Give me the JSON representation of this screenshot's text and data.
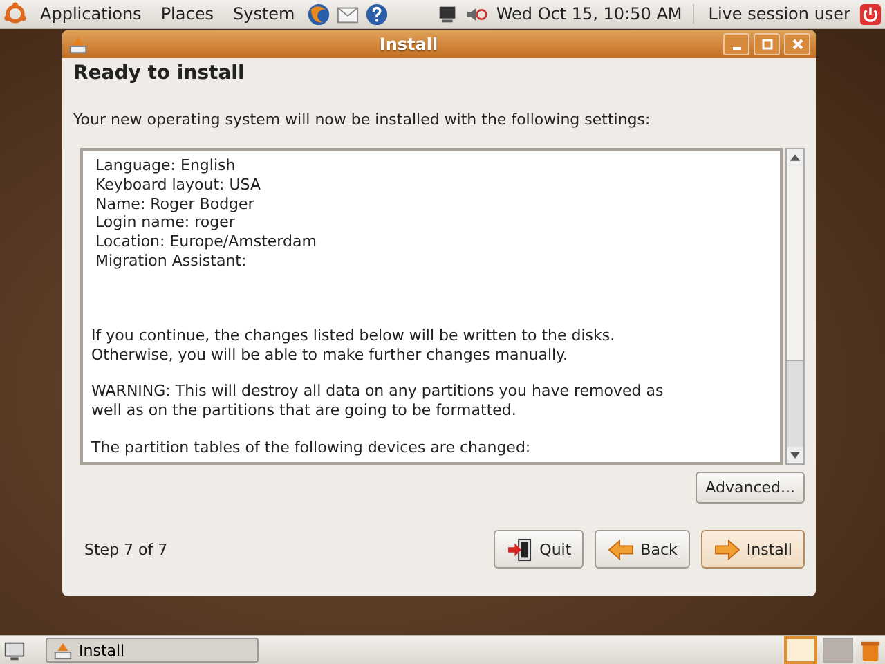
{
  "top_panel": {
    "menus": [
      "Applications",
      "Places",
      "System"
    ],
    "clock": "Wed Oct 15, 10:50 AM",
    "user": "Live session user"
  },
  "window": {
    "title": "Install",
    "heading": "Ready to install",
    "intro": "Your new operating system will now be installed with the following settings:",
    "summary_lines": [
      "Language: English",
      "Keyboard layout: USA",
      "Name: Roger Bodger",
      "Login name: roger",
      "Location: Europe/Amsterdam",
      "Migration Assistant:"
    ],
    "paragraphs": [
      [
        "If you continue, the changes listed below will be written to the disks.",
        "Otherwise, you will be able to make further changes manually."
      ],
      [
        "WARNING: This will destroy all data on any partitions you have removed as",
        "well as on the partitions that are going to be formatted."
      ],
      [
        "The partition tables of the following devices are changed:"
      ]
    ],
    "advanced_button": "Advanced...",
    "step": "Step 7 of 7",
    "buttons": [
      {
        "kind": "quit",
        "label": "Quit",
        "default": false
      },
      {
        "kind": "back",
        "label": "Back",
        "default": false
      },
      {
        "kind": "forward",
        "label": "Install",
        "default": true
      }
    ]
  },
  "bottom_panel": {
    "task": "Install",
    "workspaces": [
      {
        "selected": true
      },
      {
        "selected": false
      }
    ]
  }
}
